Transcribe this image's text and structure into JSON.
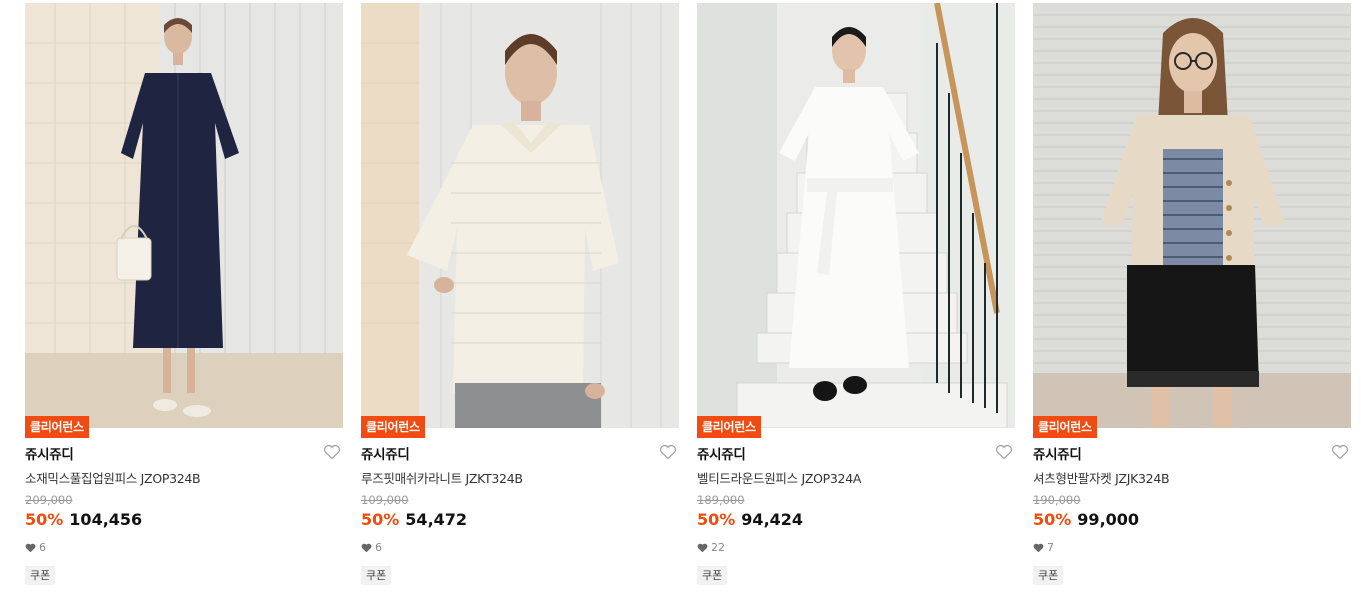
{
  "products": [
    {
      "badge": "클리어런스",
      "brand": "쥬시쥬디",
      "name": "소재믹스풀집업원피스 JZOP324B",
      "original_price": "209,000",
      "discount": "50%",
      "price": "104,456",
      "likes": "6",
      "coupon": "쿠폰",
      "photo_icon": "model-photo-navy-zip-dress"
    },
    {
      "badge": "클리어런스",
      "brand": "쥬시쥬디",
      "name": "루즈핏매쉬카라니트 JZKT324B",
      "original_price": "109,000",
      "discount": "50%",
      "price": "54,472",
      "likes": "6",
      "coupon": "쿠폰",
      "photo_icon": "model-photo-mesh-collar-knit"
    },
    {
      "badge": "클리어런스",
      "brand": "쥬시쥬디",
      "name": "벨티드라운드원피스 JZOP324A",
      "original_price": "189,000",
      "discount": "50%",
      "price": "94,424",
      "likes": "22",
      "coupon": "쿠폰",
      "photo_icon": "model-photo-white-belted-dress"
    },
    {
      "badge": "클리어런스",
      "brand": "쥬시쥬디",
      "name": "셔츠형반팔자켓 JZJK324B",
      "original_price": "190,000",
      "discount": "50%",
      "price": "99,000",
      "likes": "7",
      "coupon": "쿠폰",
      "photo_icon": "model-photo-beige-short-sleeve-jacket"
    }
  ],
  "colors": {
    "badge_bg": "#f04b12",
    "discount": "#f04b12",
    "price": "#111111",
    "original_price": "#999999"
  }
}
